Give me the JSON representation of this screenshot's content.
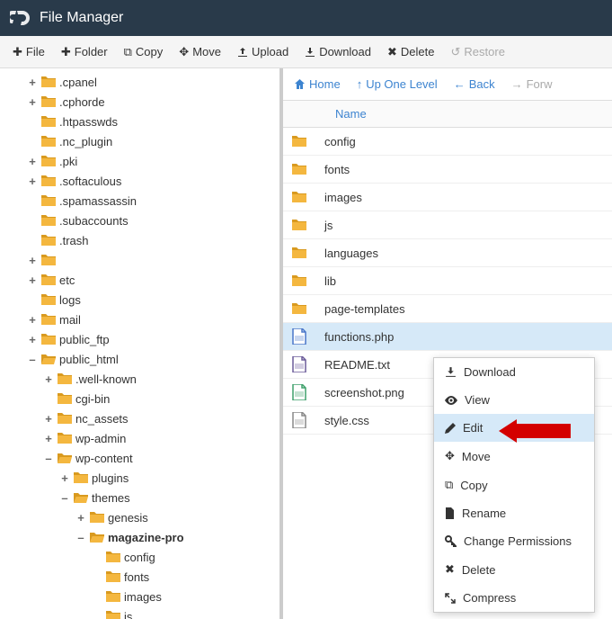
{
  "header": {
    "title": "File Manager"
  },
  "toolbar": {
    "file": "File",
    "folder": "Folder",
    "copy": "Copy",
    "move": "Move",
    "upload": "Upload",
    "download": "Download",
    "delete": "Delete",
    "restore": "Restore"
  },
  "tree": [
    {
      "label": ".cpanel",
      "depth": 1,
      "exp": "+",
      "icon": "folder"
    },
    {
      "label": ".cphorde",
      "depth": 1,
      "exp": "+",
      "icon": "folder"
    },
    {
      "label": ".htpasswds",
      "depth": 1,
      "exp": "",
      "icon": "folder"
    },
    {
      "label": ".nc_plugin",
      "depth": 1,
      "exp": "",
      "icon": "folder"
    },
    {
      "label": ".pki",
      "depth": 1,
      "exp": "+",
      "icon": "folder"
    },
    {
      "label": ".softaculous",
      "depth": 1,
      "exp": "+",
      "icon": "folder"
    },
    {
      "label": ".spamassassin",
      "depth": 1,
      "exp": "",
      "icon": "folder"
    },
    {
      "label": ".subaccounts",
      "depth": 1,
      "exp": "",
      "icon": "folder"
    },
    {
      "label": ".trash",
      "depth": 1,
      "exp": "",
      "icon": "folder"
    },
    {
      "label": " ",
      "depth": 1,
      "exp": "+",
      "icon": "folder",
      "blurred": true
    },
    {
      "label": "etc",
      "depth": 1,
      "exp": "+",
      "icon": "folder"
    },
    {
      "label": "logs",
      "depth": 1,
      "exp": "",
      "icon": "folder"
    },
    {
      "label": "mail",
      "depth": 1,
      "exp": "+",
      "icon": "folder"
    },
    {
      "label": "public_ftp",
      "depth": 1,
      "exp": "+",
      "icon": "folder"
    },
    {
      "label": "public_html",
      "depth": 1,
      "exp": "–",
      "icon": "folder-open"
    },
    {
      "label": ".well-known",
      "depth": 2,
      "exp": "+",
      "icon": "folder"
    },
    {
      "label": "cgi-bin",
      "depth": 2,
      "exp": "",
      "icon": "folder"
    },
    {
      "label": "nc_assets",
      "depth": 2,
      "exp": "+",
      "icon": "folder"
    },
    {
      "label": "wp-admin",
      "depth": 2,
      "exp": "+",
      "icon": "folder"
    },
    {
      "label": "wp-content",
      "depth": 2,
      "exp": "–",
      "icon": "folder-open"
    },
    {
      "label": "plugins",
      "depth": 3,
      "exp": "+",
      "icon": "folder"
    },
    {
      "label": "themes",
      "depth": 3,
      "exp": "–",
      "icon": "folder-open"
    },
    {
      "label": "genesis",
      "depth": 4,
      "exp": "+",
      "icon": "folder"
    },
    {
      "label": "magazine-pro",
      "depth": 4,
      "exp": "–",
      "icon": "folder-open",
      "bold": true
    },
    {
      "label": "config",
      "depth": 5,
      "exp": "",
      "icon": "folder"
    },
    {
      "label": "fonts",
      "depth": 5,
      "exp": "",
      "icon": "folder"
    },
    {
      "label": "images",
      "depth": 5,
      "exp": "",
      "icon": "folder"
    },
    {
      "label": "js",
      "depth": 5,
      "exp": "",
      "icon": "folder"
    }
  ],
  "nav": {
    "home": "Home",
    "up": "Up One Level",
    "back": "Back",
    "forward": "Forw"
  },
  "table": {
    "name_header": "Name"
  },
  "files": [
    {
      "name": "config",
      "type": "folder"
    },
    {
      "name": "fonts",
      "type": "folder"
    },
    {
      "name": "images",
      "type": "folder"
    },
    {
      "name": "js",
      "type": "folder"
    },
    {
      "name": "languages",
      "type": "folder"
    },
    {
      "name": "lib",
      "type": "folder"
    },
    {
      "name": "page-templates",
      "type": "folder"
    },
    {
      "name": "functions.php",
      "type": "php",
      "selected": true
    },
    {
      "name": "README.txt",
      "type": "txt"
    },
    {
      "name": "screenshot.png",
      "type": "png"
    },
    {
      "name": "style.css",
      "type": "css"
    }
  ],
  "context": {
    "download": "Download",
    "view": "View",
    "edit": "Edit",
    "move": "Move",
    "copy": "Copy",
    "rename": "Rename",
    "permissions": "Change Permissions",
    "delete": "Delete",
    "compress": "Compress"
  },
  "colors": {
    "folder": "#f4b73f",
    "php": "#4876c9",
    "txt": "#6b5b9a",
    "png": "#3fa06b",
    "css": "#888"
  }
}
